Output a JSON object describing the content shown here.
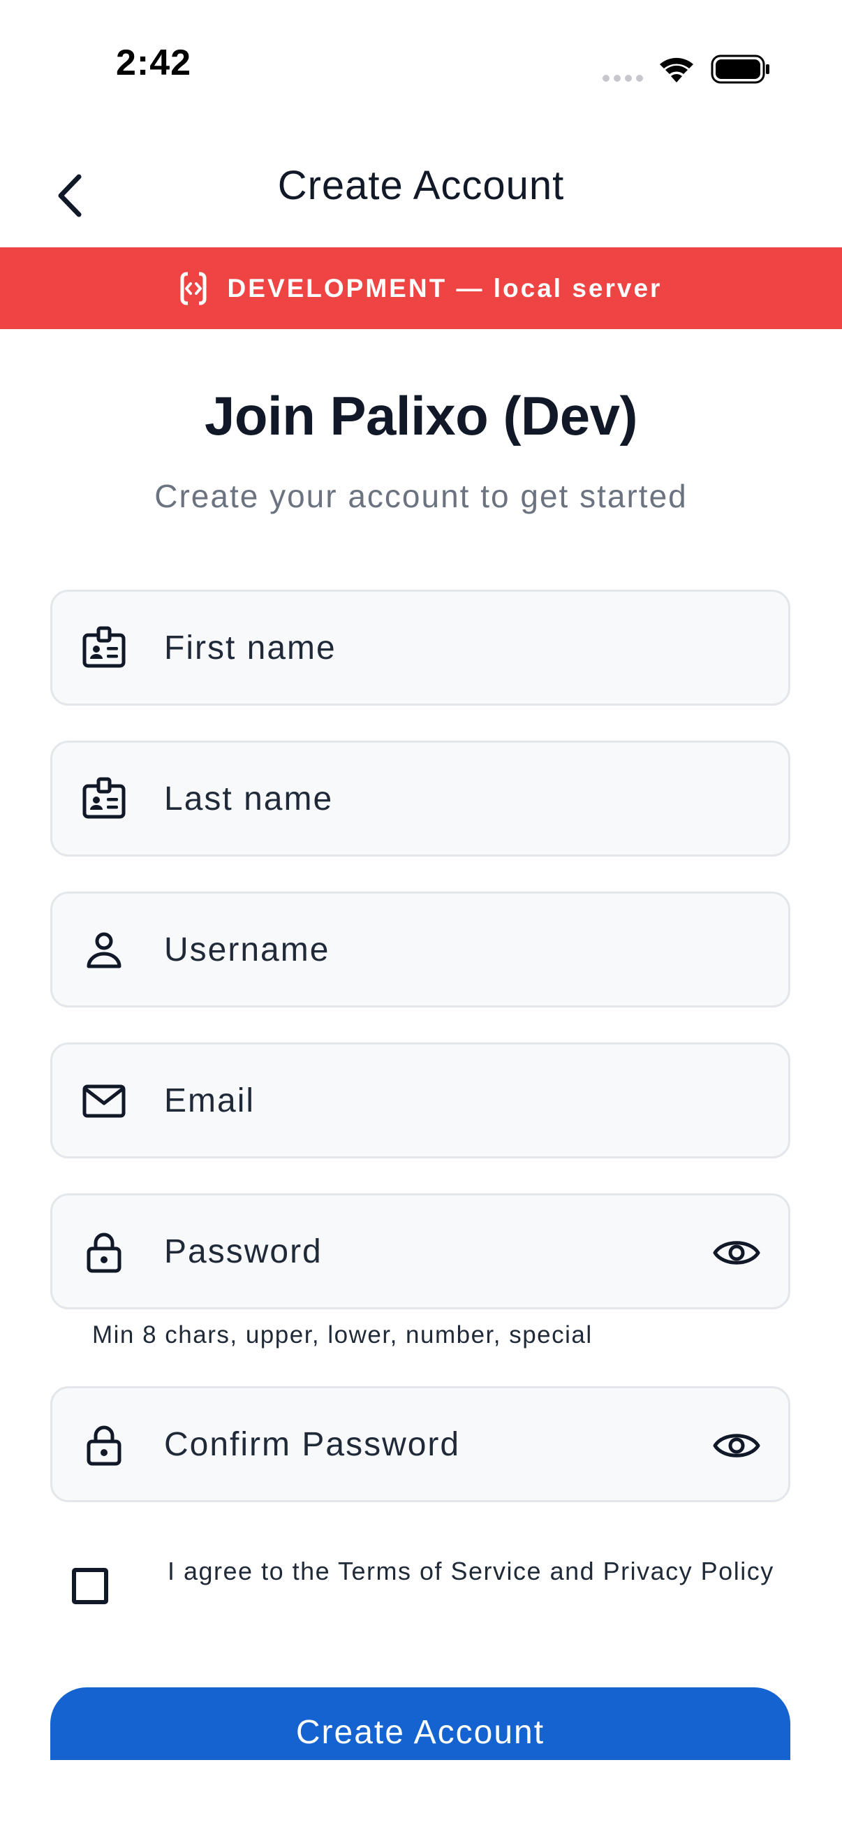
{
  "status_bar": {
    "time": "2:42"
  },
  "header": {
    "title": "Create Account"
  },
  "banner": {
    "text": "DEVELOPMENT — local server",
    "color": "#ef4444",
    "icon": "dev-code-icon"
  },
  "form": {
    "title": "Join Palixo (Dev)",
    "subtitle": "Create your account to get started",
    "fields": [
      {
        "label": "First name",
        "icon": "id-badge-icon"
      },
      {
        "label": "Last name",
        "icon": "id-badge-icon"
      },
      {
        "label": "Username",
        "icon": "person-icon"
      },
      {
        "label": "Email",
        "icon": "mail-icon"
      },
      {
        "label": "Password",
        "icon": "lock-icon"
      },
      {
        "label": "Confirm Password",
        "icon": "lock-icon"
      }
    ],
    "password_hint": "Min 8 chars, upper, lower, number, special",
    "agree_text": "I agree to the Terms of Service and Privacy Policy",
    "submit_label": "Create Account",
    "accent_color": "#1463d1"
  }
}
